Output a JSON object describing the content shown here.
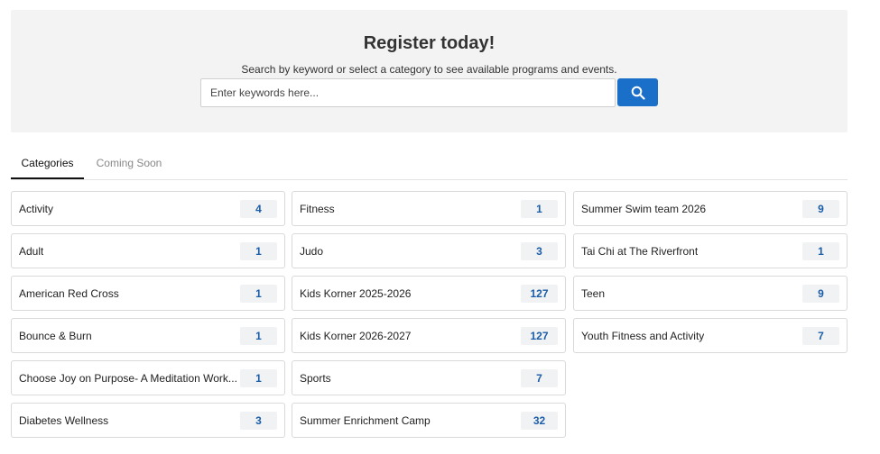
{
  "hero": {
    "title": "Register today!",
    "subtitle": "Search by keyword or select a category to see available programs and events.",
    "search_placeholder": "Enter keywords here...",
    "search_value": "",
    "search_icon": "search-icon",
    "accent_color": "#1a6fc9"
  },
  "tabs": [
    {
      "label": "Categories",
      "active": true
    },
    {
      "label": "Coming Soon",
      "active": false
    }
  ],
  "categories": [
    {
      "label": "Activity",
      "count": "4"
    },
    {
      "label": "Adult",
      "count": "1"
    },
    {
      "label": "American Red Cross",
      "count": "1"
    },
    {
      "label": "Bounce & Burn",
      "count": "1"
    },
    {
      "label": "Choose Joy on Purpose- A Meditation Work...",
      "count": "1"
    },
    {
      "label": "Diabetes Wellness",
      "count": "3"
    },
    {
      "label": "Fitness",
      "count": "1"
    },
    {
      "label": "Judo",
      "count": "3"
    },
    {
      "label": "Kids Korner 2025-2026",
      "count": "127"
    },
    {
      "label": "Kids Korner 2026-2027",
      "count": "127"
    },
    {
      "label": "Sports",
      "count": "7"
    },
    {
      "label": "Summer Enrichment Camp",
      "count": "32"
    },
    {
      "label": "Summer Swim team 2026",
      "count": "9"
    },
    {
      "label": "Tai Chi at The Riverfront",
      "count": "1"
    },
    {
      "label": "Teen",
      "count": "9"
    },
    {
      "label": "Youth Fitness and Activity",
      "count": "7"
    }
  ]
}
